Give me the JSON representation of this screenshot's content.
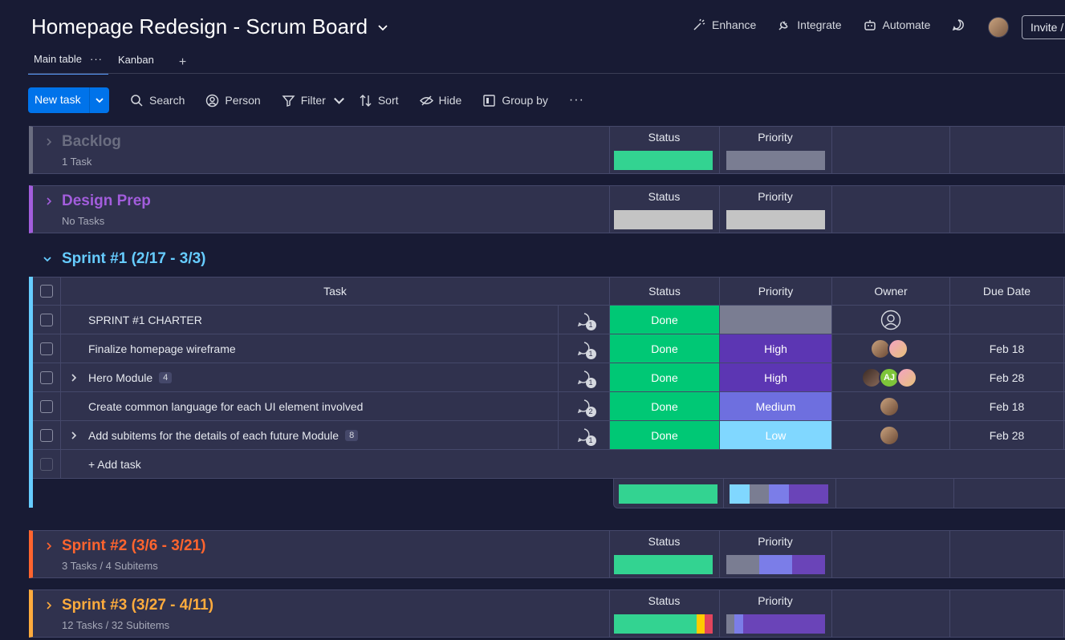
{
  "board": {
    "title": "Homepage Redesign - Scrum Board"
  },
  "top_actions": {
    "enhance": "Enhance",
    "integrate": "Integrate",
    "automate": "Automate",
    "invite": "Invite /"
  },
  "tabs": [
    {
      "label": "Main table"
    },
    {
      "label": "Kanban"
    }
  ],
  "tab_add": "+",
  "toolbar": {
    "new_task": "New task",
    "search": "Search",
    "person": "Person",
    "filter": "Filter",
    "sort": "Sort",
    "hide": "Hide",
    "group_by": "Group by"
  },
  "columns": {
    "task": "Task",
    "status": "Status",
    "priority": "Priority",
    "owner": "Owner",
    "due_date": "Due Date"
  },
  "colors": {
    "done": "#00c875",
    "high": "#5c36b3",
    "medium": "#6e6fdf",
    "low": "#80d7ff",
    "grey": "#7a7d92",
    "empty": "#c4c4c4"
  },
  "groups": [
    {
      "title": "Backlog",
      "subtitle": "1 Task",
      "color": "#6a6d80",
      "status_bar": [
        {
          "color": "#33d391",
          "share": 1
        }
      ],
      "priority_bar": [
        {
          "color": "#7a7d92",
          "share": 1
        }
      ]
    },
    {
      "title": "Design Prep",
      "subtitle": "No Tasks",
      "color": "#a25ddc",
      "status_bar": [
        {
          "color": "#c4c4c4",
          "share": 1
        }
      ],
      "priority_bar": [
        {
          "color": "#c4c4c4",
          "share": 1
        }
      ]
    },
    {
      "title": "Sprint #2 (3/6 - 3/21)",
      "subtitle": "3 Tasks / 4 Subitems",
      "color": "#ff642e",
      "status_bar": [
        {
          "color": "#33d391",
          "share": 1
        }
      ],
      "priority_bar": [
        {
          "color": "#7a7d92",
          "share": 0.33
        },
        {
          "color": "#7b7de8",
          "share": 0.34
        },
        {
          "color": "#6a44b8",
          "share": 0.33
        }
      ]
    },
    {
      "title": "Sprint #3 (3/27 - 4/11)",
      "subtitle": "12 Tasks / 32 Subitems",
      "color": "#fdab3d",
      "status_bar": [
        {
          "color": "#33d391",
          "share": 0.84
        },
        {
          "color": "#ffcb00",
          "share": 0.08
        },
        {
          "color": "#e2445c",
          "share": 0.08
        }
      ],
      "priority_bar": [
        {
          "color": "#7a7d92",
          "share": 0.08
        },
        {
          "color": "#7b7de8",
          "share": 0.09
        },
        {
          "color": "#6a44b8",
          "share": 0.83
        }
      ]
    }
  ],
  "sprint1": {
    "title": "Sprint #1 (2/17 - 3/3)",
    "rows": [
      {
        "task": "SPRINT #1 CHARTER",
        "subitems": "",
        "status": "Done",
        "priority": "",
        "priority_color": "#7a7d92",
        "due": "",
        "comments": "1",
        "owners": []
      },
      {
        "task": "Finalize homepage wireframe",
        "subitems": "",
        "status": "Done",
        "priority": "High",
        "priority_color": "#5c36b3",
        "due": "Feb 18",
        "comments": "1",
        "owners": [
          "photo",
          "dog"
        ]
      },
      {
        "task": "Hero Module",
        "subitems": "4",
        "status": "Done",
        "priority": "High",
        "priority_color": "#5c36b3",
        "due": "Feb 28",
        "comments": "1",
        "owners": [
          "woman",
          "AJ",
          "dog"
        ]
      },
      {
        "task": "Create common language for each UI element involved",
        "subitems": "",
        "status": "Done",
        "priority": "Medium",
        "priority_color": "#6e6fdf",
        "due": "Feb 18",
        "comments": "2",
        "owners": [
          "photo"
        ]
      },
      {
        "task": "Add subitems for the details of each future Module",
        "subitems": "8",
        "status": "Done",
        "priority": "Low",
        "priority_color": "#80d7ff",
        "due": "Feb 28",
        "comments": "1",
        "owners": [
          "photo"
        ]
      }
    ],
    "add_task": "+ Add task",
    "summary_status": [
      {
        "color": "#33d391",
        "share": 1
      }
    ],
    "summary_priority": [
      {
        "color": "#80d7ff",
        "share": 0.2
      },
      {
        "color": "#7a7d92",
        "share": 0.2
      },
      {
        "color": "#7b7de8",
        "share": 0.2
      },
      {
        "color": "#6a44b8",
        "share": 0.4
      }
    ]
  }
}
